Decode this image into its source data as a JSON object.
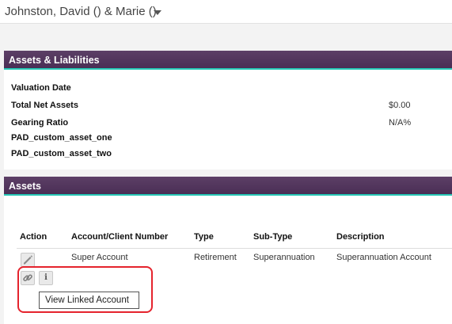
{
  "header": {
    "client_name": "Johnston, David () & Marie ()",
    "dropdown_icon": "caret-down-icon"
  },
  "assets_liabilities": {
    "title": "Assets & Liabilities",
    "rows": [
      {
        "label": "Valuation Date",
        "value": ""
      },
      {
        "label": "Total Net Assets",
        "value": "$0.00"
      },
      {
        "label": "Gearing Ratio",
        "value": "N/A%"
      },
      {
        "label": "PAD_custom_asset_one",
        "value": ""
      },
      {
        "label": "PAD_custom_asset_two",
        "value": ""
      }
    ]
  },
  "assets": {
    "title": "Assets",
    "columns": [
      "Action",
      "Account/Client Number",
      "Type",
      "Sub-Type",
      "Description"
    ],
    "rows": [
      {
        "account": "Super Account",
        "type": "Retirement",
        "subtype": "Superannuation",
        "description": "Superannuation Account",
        "actions": [
          "pencil-icon",
          "link-icon",
          "info-icon"
        ]
      }
    ],
    "info_glyph": "i",
    "tooltip": "View Linked Account"
  },
  "colors": {
    "header_purple": "#4a2e55",
    "accent_teal": "#26c7b5",
    "highlight_red": "#e5232d"
  }
}
